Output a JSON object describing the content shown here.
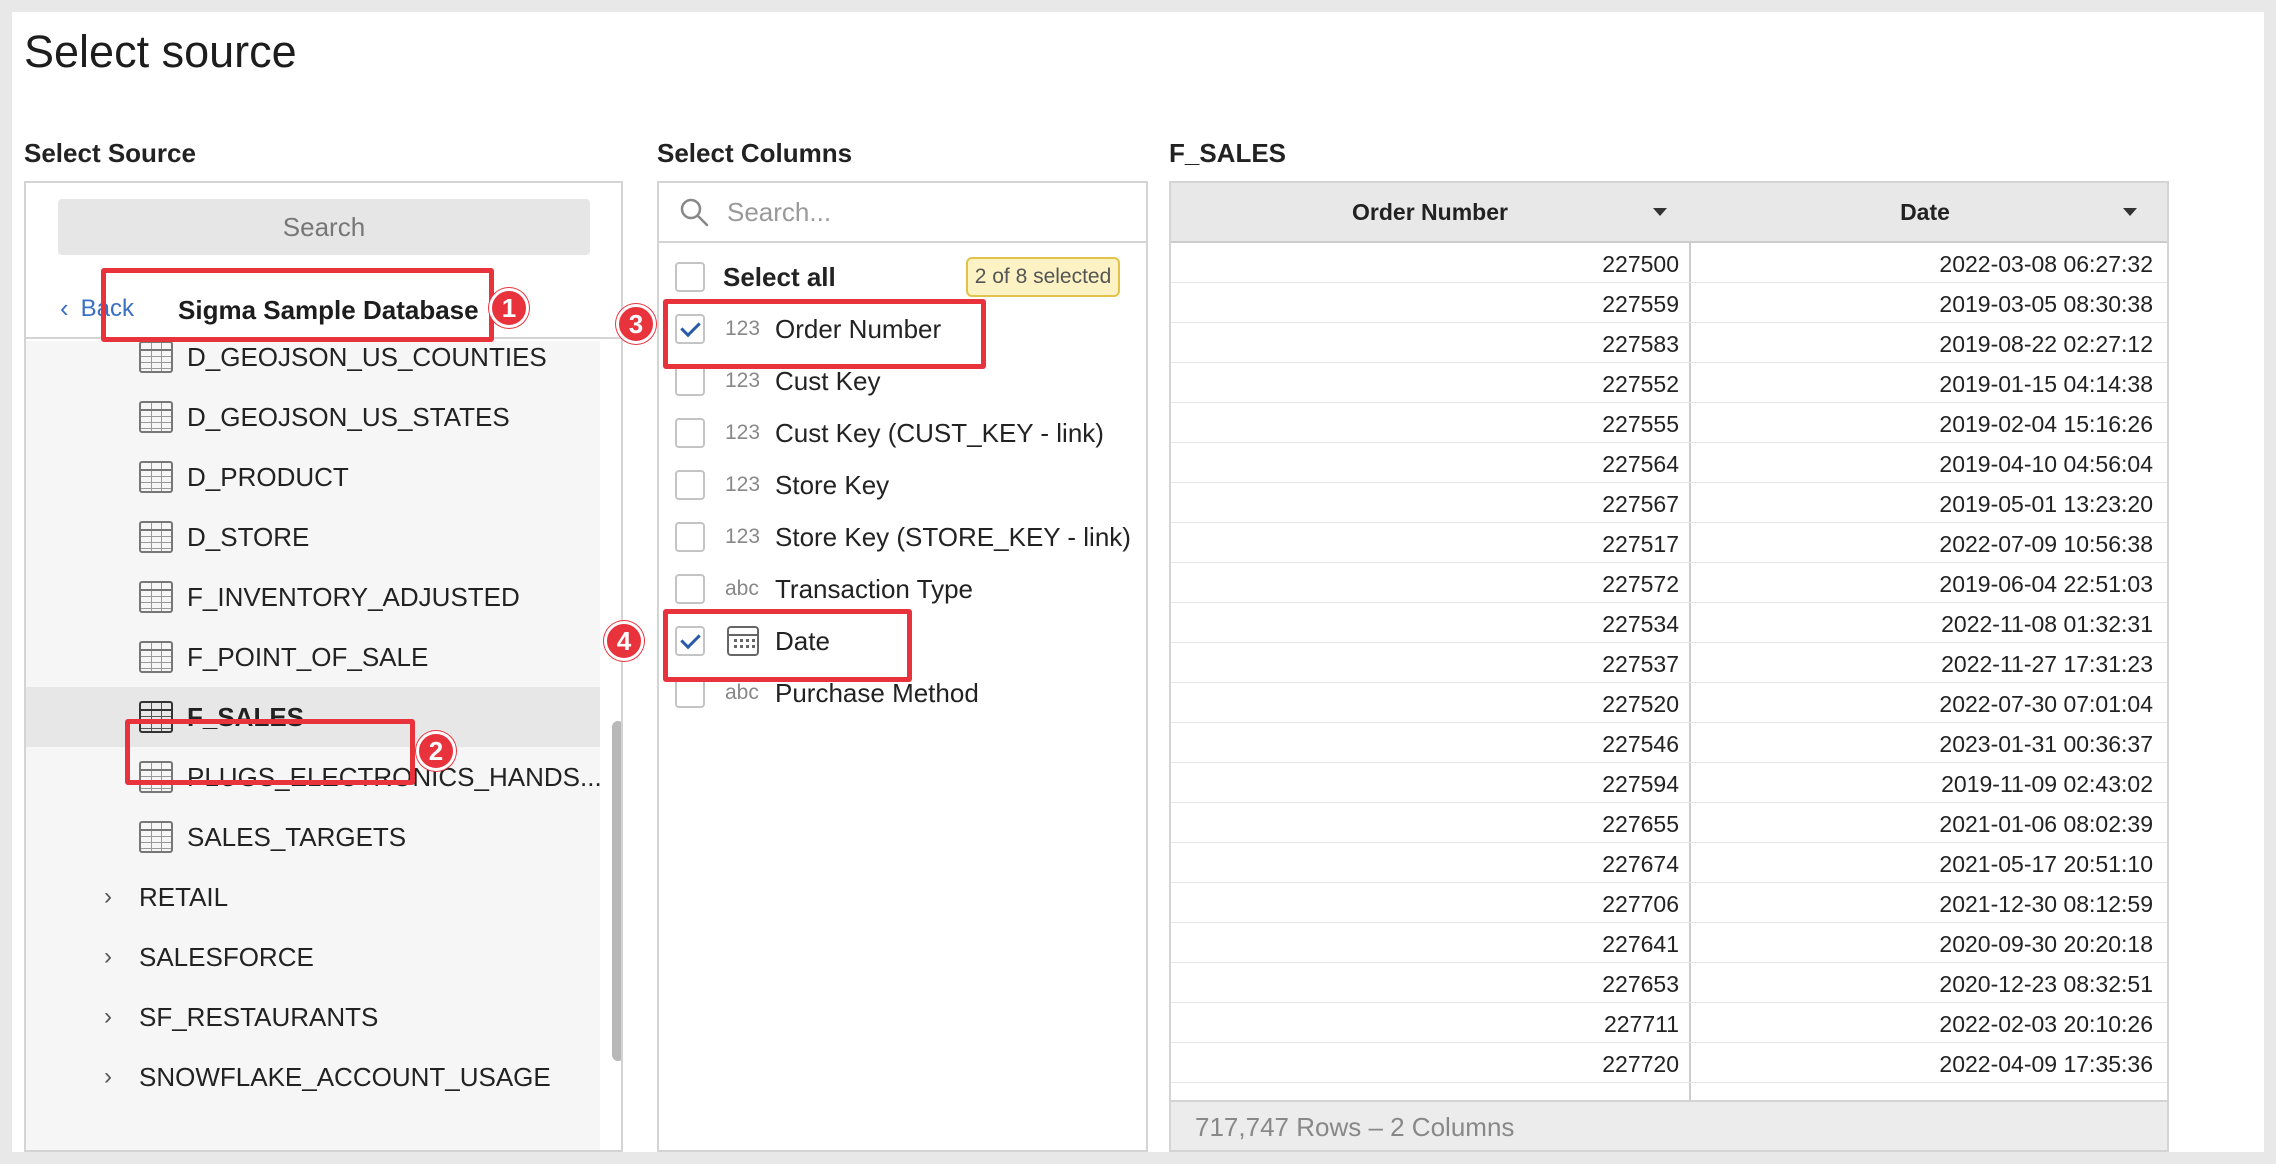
{
  "page_title": "Select source",
  "sections": {
    "source": "Select Source",
    "columns": "Select Columns",
    "preview": "F_SALES"
  },
  "source_panel": {
    "search_placeholder": "Search",
    "back_label": "Back",
    "database_name": "Sigma Sample Database",
    "tables": [
      {
        "label": "D_GEOJSON_US_COUNTIES",
        "selected": false
      },
      {
        "label": "D_GEOJSON_US_STATES",
        "selected": false
      },
      {
        "label": "D_PRODUCT",
        "selected": false
      },
      {
        "label": "D_STORE",
        "selected": false
      },
      {
        "label": "F_INVENTORY_ADJUSTED",
        "selected": false
      },
      {
        "label": "F_POINT_OF_SALE",
        "selected": false
      },
      {
        "label": "F_SALES",
        "selected": true
      },
      {
        "label": "PLUGS_ELECTRONICS_HANDS...",
        "selected": false
      },
      {
        "label": "SALES_TARGETS",
        "selected": false
      }
    ],
    "folders": [
      "RETAIL",
      "SALESFORCE",
      "SF_RESTAURANTS",
      "SNOWFLAKE_ACCOUNT_USAGE"
    ]
  },
  "columns_panel": {
    "search_placeholder": "Search...",
    "select_all_label": "Select all",
    "selected_badge": "2 of 8 selected",
    "columns": [
      {
        "type": "123",
        "name": "Order Number",
        "checked": true
      },
      {
        "type": "123",
        "name": "Cust Key",
        "checked": false
      },
      {
        "type": "123",
        "name": "Cust Key (CUST_KEY - link)",
        "checked": false
      },
      {
        "type": "123",
        "name": "Store Key",
        "checked": false
      },
      {
        "type": "123",
        "name": "Store Key (STORE_KEY - link)",
        "checked": false
      },
      {
        "type": "abc",
        "name": "Transaction Type",
        "checked": false
      },
      {
        "type": "calendar-icon",
        "name": "Date",
        "checked": true
      },
      {
        "type": "abc",
        "name": "Purchase Method",
        "checked": false
      }
    ]
  },
  "preview": {
    "headers": [
      "Order Number",
      "Date"
    ],
    "rows": [
      [
        "227500",
        "2022-03-08 06:27:32"
      ],
      [
        "227559",
        "2019-03-05 08:30:38"
      ],
      [
        "227583",
        "2019-08-22 02:27:12"
      ],
      [
        "227552",
        "2019-01-15 04:14:38"
      ],
      [
        "227555",
        "2019-02-04 15:16:26"
      ],
      [
        "227564",
        "2019-04-10 04:56:04"
      ],
      [
        "227567",
        "2019-05-01 13:23:20"
      ],
      [
        "227517",
        "2022-07-09 10:56:38"
      ],
      [
        "227572",
        "2019-06-04 22:51:03"
      ],
      [
        "227534",
        "2022-11-08 01:32:31"
      ],
      [
        "227537",
        "2022-11-27 17:31:23"
      ],
      [
        "227520",
        "2022-07-30 07:01:04"
      ],
      [
        "227546",
        "2023-01-31 00:36:37"
      ],
      [
        "227594",
        "2019-11-09 02:43:02"
      ],
      [
        "227655",
        "2021-01-06 08:02:39"
      ],
      [
        "227674",
        "2021-05-17 20:51:10"
      ],
      [
        "227706",
        "2021-12-30 08:12:59"
      ],
      [
        "227641",
        "2020-09-30 20:20:18"
      ],
      [
        "227653",
        "2020-12-23 08:32:51"
      ],
      [
        "227711",
        "2022-02-03 20:10:26"
      ],
      [
        "227720",
        "2022-04-09 17:35:36"
      ]
    ],
    "footer": "717,747 Rows – 2 Columns"
  },
  "callouts": [
    "1",
    "2",
    "3",
    "4"
  ],
  "colors": {
    "callout": "#e8323c",
    "link": "#3a6fc4",
    "check": "#2a5aa8",
    "badge_bg": "#fdf2c4"
  }
}
